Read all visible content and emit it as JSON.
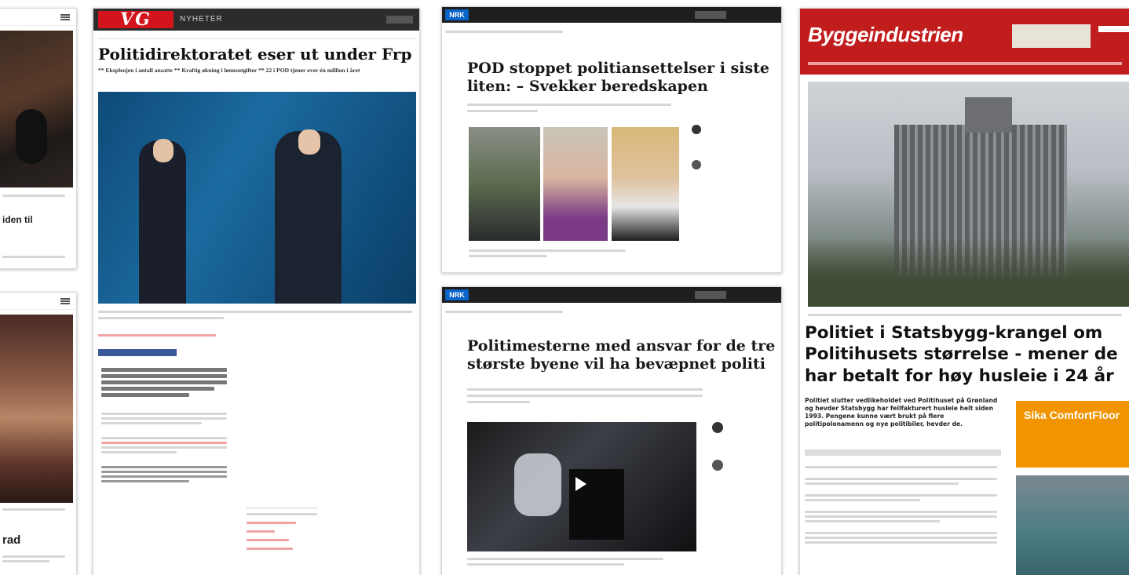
{
  "left_top": {
    "headline_fragment": "iden til"
  },
  "left_bottom": {
    "headline_fragment": "rad"
  },
  "vg": {
    "logo": "VG",
    "section": "NYHETER",
    "headline": "Politidirektoratet eser ut under Frp",
    "subhead": "** Ekspleojen i antall ansatte ** Kraftig økning i lønnsutgifter ** 22 i POD tjener over én million i året"
  },
  "nrk_top": {
    "logo": "NRK",
    "headline": "POD stoppet politiansettelser i siste liten: – Svekker beredskapen"
  },
  "nrk_bottom": {
    "logo": "NRK",
    "headline": "Politimesterne med ansvar for de tre største byene vil ha bevæpnet politi"
  },
  "byggeindustrien": {
    "logo": "Byggeindustrien",
    "headline": "Politiet i Statsbygg-krangel om Politihusets størrelse - mener de har betalt for høy husleie i 24 år",
    "lead": "Politiet slutter vedlikeholdet ved Politihuset på Grønland og hevder Statsbygg har feilfakturert husleie helt siden 1993. Pengene kunne vært brukt på flere politipolonamenn og nye politibiler, hevder de.",
    "ad_title": "Sika ComfortFloor"
  },
  "colors": {
    "vg_red": "#d4141c",
    "nrk_blue": "#0a63c9",
    "bi_red": "#c21d1d",
    "ad_orange": "#f29400"
  }
}
